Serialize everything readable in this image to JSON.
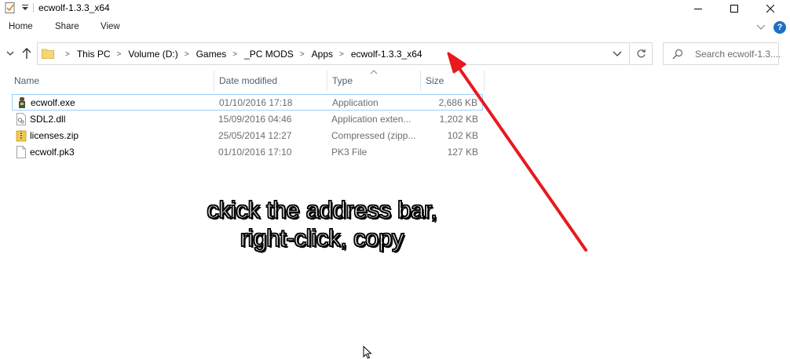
{
  "window": {
    "title": "ecwolf-1.3.3_x64",
    "minimize_glyph": "—",
    "maximize_glyph": "☐",
    "close_glyph": "✕"
  },
  "ribbon": {
    "tabs": [
      "Home",
      "Share",
      "View"
    ],
    "help_label": "?"
  },
  "address": {
    "crumbs": [
      "This PC",
      "Volume (D:)",
      "Games",
      "_PC MODS",
      "Apps",
      "ecwolf-1.3.3_x64"
    ],
    "separator": ">"
  },
  "search": {
    "placeholder": "Search ecwolf-1.3...."
  },
  "columns": {
    "name": "Name",
    "date": "Date modified",
    "type": "Type",
    "size": "Size"
  },
  "files": [
    {
      "name": "ecwolf.exe",
      "date": "01/10/2016 17:18",
      "type": "Application",
      "size": "2,686 KB",
      "icon": "exe-icon",
      "selected": true
    },
    {
      "name": "SDL2.dll",
      "date": "15/09/2016 04:46",
      "type": "Application exten...",
      "size": "1,202 KB",
      "icon": "dll-icon",
      "selected": false
    },
    {
      "name": "licenses.zip",
      "date": "25/05/2014 12:27",
      "type": "Compressed (zipp...",
      "size": "102 KB",
      "icon": "zip-folder-icon",
      "selected": false
    },
    {
      "name": "ecwolf.pk3",
      "date": "01/10/2016 17:10",
      "type": "PK3 File",
      "size": "127 KB",
      "icon": "file-icon",
      "selected": false
    }
  ],
  "annotation": {
    "lines": [
      "ckick the address bar,",
      "right-click, copy"
    ],
    "arrow_color": "#e8191f"
  },
  "colors": {
    "selection_border": "#99d1ff",
    "header_text": "#4c607a",
    "accent": "#1e6fc4"
  }
}
